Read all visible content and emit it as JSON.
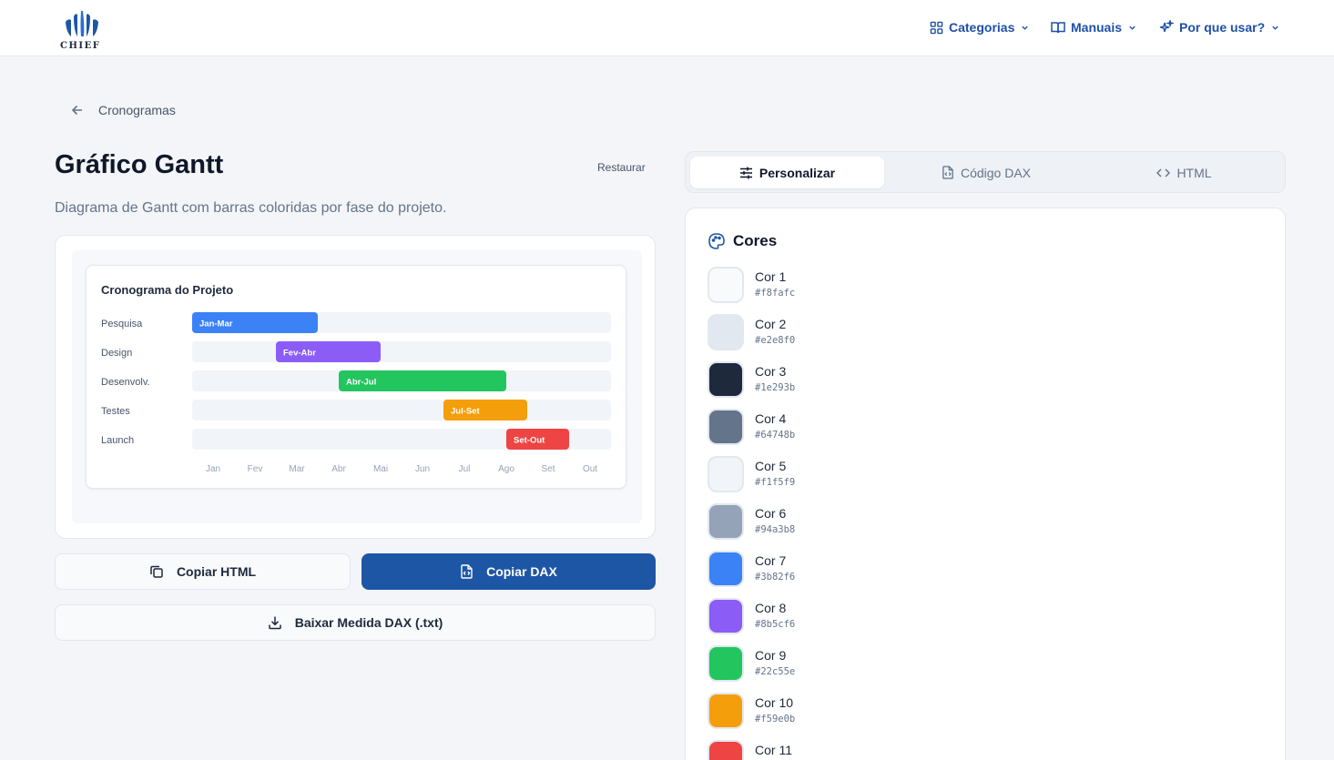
{
  "header": {
    "logo_text": "CHIEF",
    "nav": [
      {
        "label": "Categorias",
        "icon": "grid-icon"
      },
      {
        "label": "Manuais",
        "icon": "book-icon"
      },
      {
        "label": "Por que usar?",
        "icon": "sparkles-icon"
      }
    ]
  },
  "breadcrumb": {
    "label": "Cronogramas"
  },
  "page": {
    "title": "Gráfico Gantt",
    "restore_label": "Restaurar",
    "description": "Diagrama de Gantt com barras coloridas por fase do projeto."
  },
  "chart_data": {
    "type": "gantt",
    "title": "Cronograma do Projeto",
    "months": [
      "Jan",
      "Fev",
      "Mar",
      "Abr",
      "Mai",
      "Jun",
      "Jul",
      "Ago",
      "Set",
      "Out"
    ],
    "tasks": [
      {
        "name": "Pesquisa",
        "label": "Jan-Mar",
        "start": 0,
        "end": 3,
        "color": "#3b82f6"
      },
      {
        "name": "Design",
        "label": "Fev-Abr",
        "start": 2,
        "end": 4.5,
        "color": "#8b5cf6"
      },
      {
        "name": "Desenvolv.",
        "label": "Abr-Jul",
        "start": 3.5,
        "end": 7.5,
        "color": "#22c55e"
      },
      {
        "name": "Testes",
        "label": "Jul-Set",
        "start": 6,
        "end": 8,
        "color": "#f59e0b"
      },
      {
        "name": "Launch",
        "label": "Set-Out",
        "start": 7.5,
        "end": 9,
        "color": "#ef4444"
      }
    ],
    "track_color": "#f1f5f9"
  },
  "actions": {
    "copy_html": "Copiar HTML",
    "copy_dax": "Copiar DAX",
    "download": "Baixar Medida DAX (.txt)"
  },
  "tabs": [
    {
      "label": "Personalizar",
      "active": true
    },
    {
      "label": "Código DAX",
      "active": false
    },
    {
      "label": "HTML",
      "active": false
    }
  ],
  "colors_panel": {
    "title": "Cores",
    "colors": [
      {
        "name": "Cor 1",
        "hex": "#f8fafc"
      },
      {
        "name": "Cor 2",
        "hex": "#e2e8f0"
      },
      {
        "name": "Cor 3",
        "hex": "#1e293b"
      },
      {
        "name": "Cor 4",
        "hex": "#64748b"
      },
      {
        "name": "Cor 5",
        "hex": "#f1f5f9"
      },
      {
        "name": "Cor 6",
        "hex": "#94a3b8"
      },
      {
        "name": "Cor 7",
        "hex": "#3b82f6"
      },
      {
        "name": "Cor 8",
        "hex": "#8b5cf6"
      },
      {
        "name": "Cor 9",
        "hex": "#22c55e"
      },
      {
        "name": "Cor 10",
        "hex": "#f59e0b"
      },
      {
        "name": "Cor 11",
        "hex": "#ef4444"
      }
    ]
  }
}
